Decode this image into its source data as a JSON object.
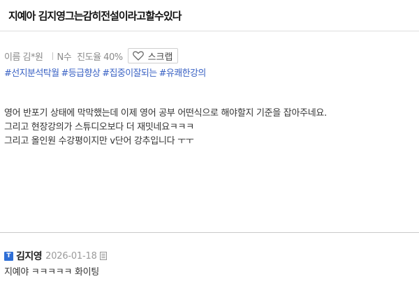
{
  "post": {
    "title": "지예아 김지영그는감히전설이라고할수있다"
  },
  "meta": {
    "name": "이름 김*원",
    "grade": "N수",
    "progress": "진도율 40%",
    "scrap_label": "스크랩",
    "scrap_icon": "heart-icon"
  },
  "tags": [
    "#선지분석탁월",
    "#등급향상",
    "#집중이잘되는",
    "#유쾌한강의"
  ],
  "content": {
    "lines": [
      "영어 반포기 상태에 막막했는데 이제 영어 공부 어떤식으로 해야할지 기준을 잡아주네요.",
      "그리고 현장강의가 스튜디오보다 더 재밋네요ㅋㅋㅋ",
      "그리고 올인원 수강평이지만 v단어 강추입니다 ㅜㅜ"
    ]
  },
  "comment": {
    "badge": "T",
    "author": "김지영",
    "date": "2026-01-18",
    "text": "지예야 ㅋㅋㅋㅋㅋ 화이팅"
  },
  "colors": {
    "tag": "#3a62c4",
    "badge": "#2f6fd6"
  }
}
